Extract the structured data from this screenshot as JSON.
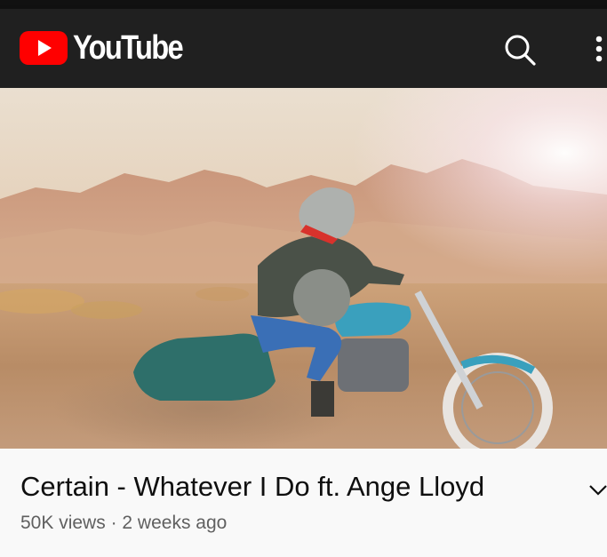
{
  "app": {
    "name": "YouTube",
    "brand_color": "#FF0000",
    "header_bg": "#202020"
  },
  "header": {
    "logo_text": "YouTube",
    "icons": [
      "youtube-logo-icon",
      "search-icon",
      "more-vert-icon"
    ]
  },
  "video": {
    "title": "Certain - Whatever I Do ft. Ange Lloyd",
    "views": "50K views",
    "separator": "·",
    "age": "2 weeks ago",
    "thumbnail_description_icon": "video-frame"
  }
}
